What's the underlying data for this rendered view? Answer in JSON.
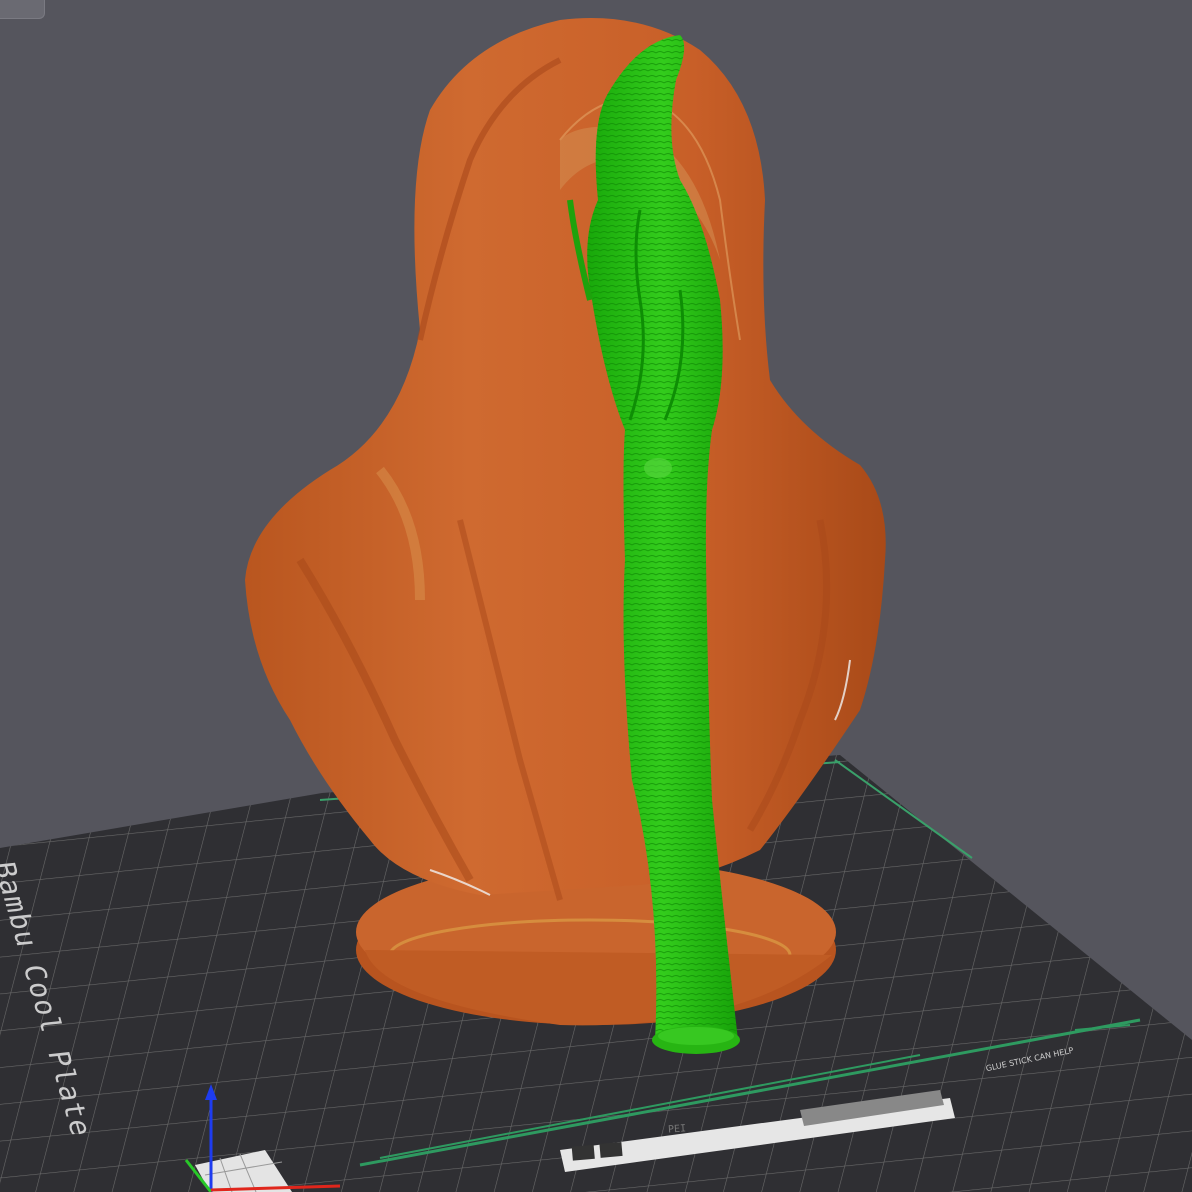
{
  "viewport": {
    "bed": {
      "plate_name": "Bambu Cool Plate",
      "glue_note": "GLUE STICK CAN HELP",
      "plate_code": "PEI"
    },
    "model": {
      "body_color": "#c8602a",
      "support_color": "#22b80f"
    },
    "axes": {
      "x_color": "#e0261c",
      "y_color": "#28c828",
      "z_color": "#1e3cf0"
    }
  }
}
